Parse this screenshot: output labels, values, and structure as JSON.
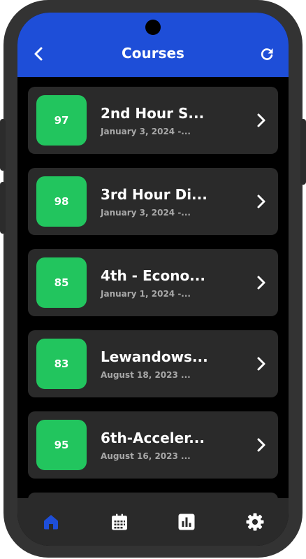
{
  "header": {
    "title": "Courses",
    "back_icon": "chevron-left-icon",
    "refresh_icon": "refresh-icon",
    "background": "#1e4ed8"
  },
  "courses": [
    {
      "grade": "97",
      "title": "2nd Hour S...",
      "date": "January 3, 2024 -..."
    },
    {
      "grade": "98",
      "title": "3rd Hour Di...",
      "date": "January 3, 2024 -..."
    },
    {
      "grade": "85",
      "title": "4th - Econo...",
      "date": "January 1, 2024 -..."
    },
    {
      "grade": "83",
      "title": "Lewandows...",
      "date": "August 18, 2023 ..."
    },
    {
      "grade": "95",
      "title": "6th-Acceler...",
      "date": "August 16, 2023 ..."
    }
  ],
  "grade_color": "#22c55e",
  "nav": {
    "items": [
      {
        "icon": "home-icon",
        "active": true
      },
      {
        "icon": "calendar-icon",
        "active": false
      },
      {
        "icon": "chart-icon",
        "active": false
      },
      {
        "icon": "gear-icon",
        "active": false
      }
    ],
    "active_color": "#1e4ed8",
    "inactive_color": "#ffffff"
  }
}
